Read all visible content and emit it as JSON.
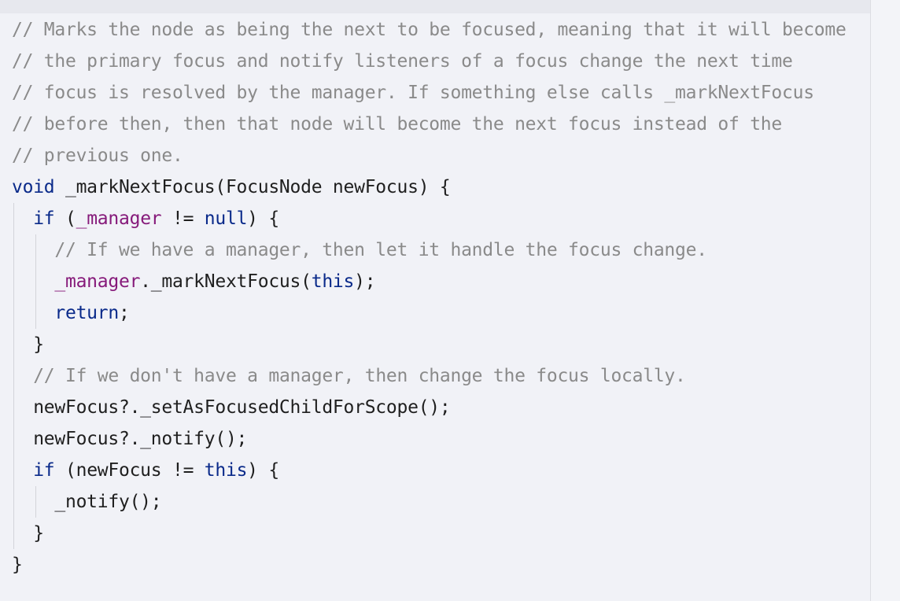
{
  "editor": {
    "colors": {
      "background": "#f1f2f7",
      "comment": "#8a8a8a",
      "keyword": "#0a2a8a",
      "field": "#861a7a",
      "default": "#1f1f1f"
    },
    "lines": [
      {
        "tokens": [
          {
            "kind": "comment",
            "text": "// Marks the node as being the next to be focused, meaning that it will become"
          }
        ]
      },
      {
        "tokens": [
          {
            "kind": "comment",
            "text": "// the primary focus and notify listeners of a focus change the next time"
          }
        ]
      },
      {
        "tokens": [
          {
            "kind": "comment",
            "text": "// focus is resolved by the manager. If something else calls _markNextFocus"
          }
        ]
      },
      {
        "tokens": [
          {
            "kind": "comment",
            "text": "// before then, then that node will become the next focus instead of the"
          }
        ]
      },
      {
        "tokens": [
          {
            "kind": "comment",
            "text": "// previous one."
          }
        ]
      },
      {
        "tokens": [
          {
            "kind": "keyword",
            "text": "void"
          },
          {
            "kind": "default",
            "text": " _markNextFocus(FocusNode newFocus) {"
          }
        ]
      },
      {
        "tokens": [
          {
            "kind": "default",
            "text": "  "
          },
          {
            "kind": "keyword",
            "text": "if"
          },
          {
            "kind": "default",
            "text": " ("
          },
          {
            "kind": "field",
            "text": "_manager"
          },
          {
            "kind": "default",
            "text": " != "
          },
          {
            "kind": "keyword",
            "text": "null"
          },
          {
            "kind": "default",
            "text": ") {"
          }
        ]
      },
      {
        "tokens": [
          {
            "kind": "default",
            "text": "    "
          },
          {
            "kind": "comment",
            "text": "// If we have a manager, then let it handle the focus change."
          }
        ]
      },
      {
        "tokens": [
          {
            "kind": "default",
            "text": "    "
          },
          {
            "kind": "field",
            "text": "_manager"
          },
          {
            "kind": "default",
            "text": "._markNextFocus("
          },
          {
            "kind": "keyword",
            "text": "this"
          },
          {
            "kind": "default",
            "text": ");"
          }
        ]
      },
      {
        "tokens": [
          {
            "kind": "default",
            "text": "    "
          },
          {
            "kind": "keyword",
            "text": "return"
          },
          {
            "kind": "default",
            "text": ";"
          }
        ]
      },
      {
        "tokens": [
          {
            "kind": "default",
            "text": "  }"
          }
        ]
      },
      {
        "tokens": [
          {
            "kind": "default",
            "text": "  "
          },
          {
            "kind": "comment",
            "text": "// If we don't have a manager, then change the focus locally."
          }
        ]
      },
      {
        "tokens": [
          {
            "kind": "default",
            "text": "  newFocus?._setAsFocusedChildForScope();"
          }
        ]
      },
      {
        "tokens": [
          {
            "kind": "default",
            "text": "  newFocus?._notify();"
          }
        ]
      },
      {
        "tokens": [
          {
            "kind": "default",
            "text": "  "
          },
          {
            "kind": "keyword",
            "text": "if"
          },
          {
            "kind": "default",
            "text": " (newFocus != "
          },
          {
            "kind": "keyword",
            "text": "this"
          },
          {
            "kind": "default",
            "text": ") {"
          }
        ]
      },
      {
        "tokens": [
          {
            "kind": "default",
            "text": "    _notify();"
          }
        ]
      },
      {
        "tokens": [
          {
            "kind": "default",
            "text": "  }"
          }
        ]
      },
      {
        "tokens": [
          {
            "kind": "default",
            "text": "}"
          }
        ]
      }
    ]
  }
}
